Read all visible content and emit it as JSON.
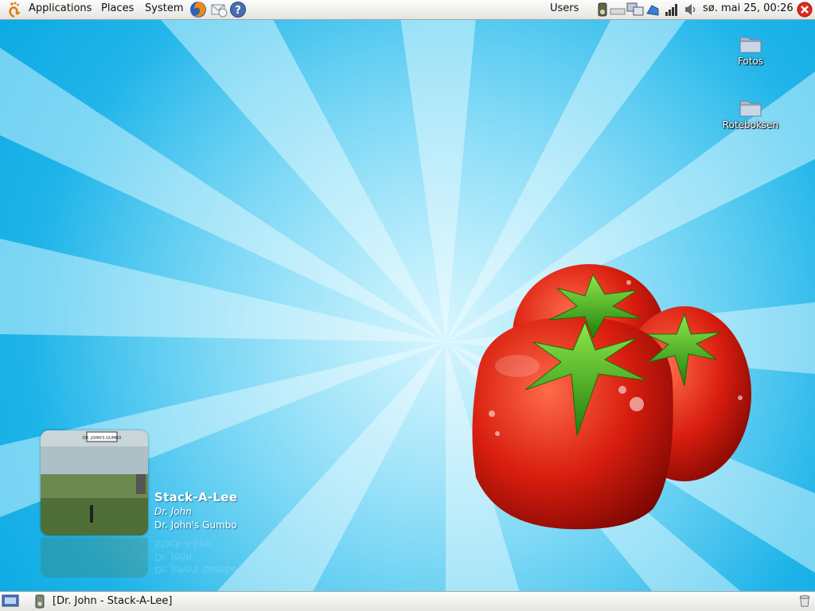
{
  "top_panel": {
    "menus": {
      "applications": "Applications",
      "places": "Places",
      "system": "System"
    },
    "users": "Users",
    "clock": "sø. mai 25, 00:26"
  },
  "desktop": {
    "icons": [
      {
        "label": "Fotos"
      },
      {
        "label": "Roteboksen"
      }
    ]
  },
  "now_playing": {
    "title": "Stack-A-Lee",
    "artist": "Dr. John",
    "album": "Dr. John's Gumbo",
    "cover_sign": "DR. JOHN'S GUMBO"
  },
  "bottom_panel": {
    "task": "[Dr. John - Stack-A-Lee]"
  },
  "colors": {
    "sky": "#12b9ec",
    "ray": "#bfeefc",
    "tomato": "#d81d0e",
    "stem": "#3faa1a",
    "close": "#e02a1c"
  },
  "icons": [
    "gnome-foot-icon",
    "firefox-icon",
    "mail-icon",
    "help-icon",
    "tray-icons",
    "close-icon",
    "show-desktop-icon",
    "trash-icon"
  ]
}
